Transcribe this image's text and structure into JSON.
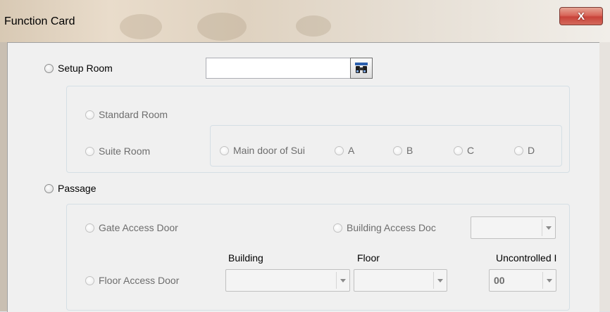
{
  "window": {
    "title": "Function Card",
    "close_glyph": "X"
  },
  "setup_room": {
    "label": "Setup Room",
    "room_input_value": "",
    "lookup_icon": "binoculars-icon",
    "standard_room_label": "Standard Room",
    "suite_room_label": "Suite Room",
    "suite_doors": {
      "main_door_label": "Main door of Sui",
      "a_label": "A",
      "b_label": "B",
      "c_label": "C",
      "d_label": "D"
    }
  },
  "passage": {
    "label": "Passage",
    "gate_access_label": "Gate Access Door",
    "building_access_label": "Building Access Doc",
    "building_access_value": "",
    "floor_access_label": "Floor Access Door",
    "building_header": "Building",
    "floor_header": "Floor",
    "uncontrolled_header": "Uncontrolled I",
    "building_value": "",
    "floor_value": "",
    "uncontrolled_value": "00"
  },
  "colors": {
    "close_button": "#c8433a",
    "dialog_bg": "#f0f0f0",
    "group_border": "#d5dfe5"
  }
}
